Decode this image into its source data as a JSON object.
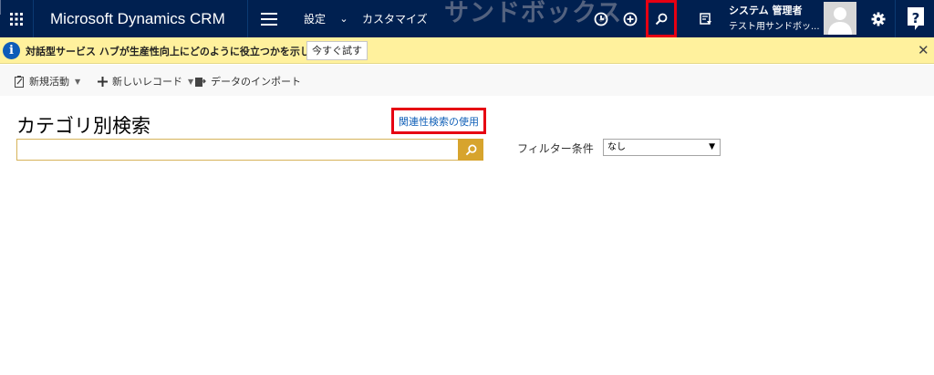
{
  "topbar": {
    "brand": "Microsoft Dynamics CRM",
    "nav_settings": "設定",
    "nav_caret": "⌄",
    "nav_customize": "カスタマイズ",
    "watermark": "サンドボックス",
    "user_role": "システム 管理者",
    "user_org": "テスト用サンドボッ...",
    "icons": [
      "app-launcher-icon",
      "hamburger-menu-icon",
      "history-icon",
      "add-icon",
      "search-icon",
      "task-icon",
      "user-avatar-icon",
      "gear-icon",
      "help-icon"
    ]
  },
  "notification": {
    "info_glyph": "i",
    "text": "対話型サービス ハブが生産性向上にどのように役立つかを示します。",
    "button_label": "今すぐ試す",
    "close_glyph": "✕"
  },
  "commands": {
    "new_activity": "新規活動",
    "new_record": "新しいレコード",
    "import_data": "データのインポート",
    "caret": "▼"
  },
  "main": {
    "title": "カテゴリ別検索",
    "relevance_link": "関連性検索の使用",
    "search_value": "",
    "filter_label": "フィルター条件",
    "filter_value": "なし",
    "filter_arrow": "▼"
  },
  "colors": {
    "topbar_bg": "#002050",
    "notification_bg": "#fff19d",
    "search_button": "#d7a42d",
    "highlight_box": "#e60012",
    "link": "#1060b8"
  }
}
